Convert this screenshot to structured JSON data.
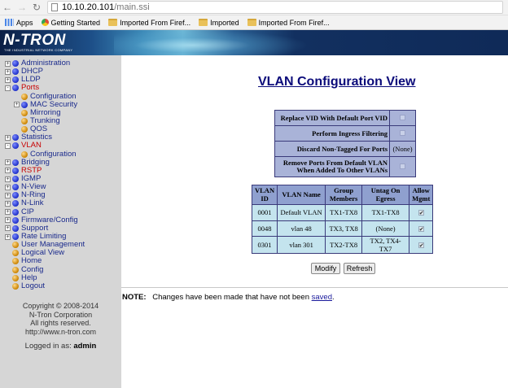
{
  "browser": {
    "url_host": "10.10.20.101",
    "url_path": "/main.ssi",
    "bookmarks": [
      "Apps",
      "Getting Started",
      "Imported From Firef...",
      "Imported",
      "Imported From Firef..."
    ]
  },
  "banner": {
    "logo": "N-TRON",
    "tagline": "THE INDUSTRIAL NETWORK COMPANY"
  },
  "sidebar": {
    "items": [
      {
        "label": "Administration",
        "level": 0,
        "expander": "+",
        "icon": "blue-ball-icon"
      },
      {
        "label": "DHCP",
        "level": 0,
        "expander": "+",
        "icon": "blue-ball-icon"
      },
      {
        "label": "LLDP",
        "level": 0,
        "expander": "+",
        "icon": "blue-ball-icon"
      },
      {
        "label": "Ports",
        "level": 0,
        "expander": "-",
        "icon": "blue-ball-icon",
        "red": true
      },
      {
        "label": "Configuration",
        "level": 1,
        "expander": "",
        "icon": "gold-ball-icon"
      },
      {
        "label": "MAC Security",
        "level": 1,
        "expander": "+",
        "icon": "blue-ball-icon"
      },
      {
        "label": "Mirroring",
        "level": 1,
        "expander": "",
        "icon": "gold-ball-icon"
      },
      {
        "label": "Trunking",
        "level": 1,
        "expander": "",
        "icon": "gold-ball-icon"
      },
      {
        "label": "QOS",
        "level": 1,
        "expander": "",
        "icon": "gold-ball-icon"
      },
      {
        "label": "Statistics",
        "level": 0,
        "expander": "+",
        "icon": "blue-ball-icon"
      },
      {
        "label": "VLAN",
        "level": 0,
        "expander": "-",
        "icon": "blue-ball-icon",
        "red": true
      },
      {
        "label": "Configuration",
        "level": 1,
        "expander": "",
        "icon": "gold-ball-icon"
      },
      {
        "label": "Bridging",
        "level": 0,
        "expander": "+",
        "icon": "blue-ball-icon"
      },
      {
        "label": "RSTP",
        "level": 0,
        "expander": "+",
        "icon": "blue-ball-icon",
        "red": true
      },
      {
        "label": "IGMP",
        "level": 0,
        "expander": "+",
        "icon": "blue-ball-icon"
      },
      {
        "label": "N-View",
        "level": 0,
        "expander": "+",
        "icon": "blue-ball-icon"
      },
      {
        "label": "N-Ring",
        "level": 0,
        "expander": "+",
        "icon": "blue-ball-icon"
      },
      {
        "label": "N-Link",
        "level": 0,
        "expander": "+",
        "icon": "blue-ball-icon"
      },
      {
        "label": "CIP",
        "level": 0,
        "expander": "+",
        "icon": "blue-ball-icon"
      },
      {
        "label": "Firmware/Config",
        "level": 0,
        "expander": "+",
        "icon": "blue-ball-icon"
      },
      {
        "label": "Support",
        "level": 0,
        "expander": "+",
        "icon": "blue-ball-icon"
      },
      {
        "label": "Rate Limiting",
        "level": 0,
        "expander": "+",
        "icon": "blue-ball-icon"
      },
      {
        "label": "User Management",
        "level": 0,
        "expander": "",
        "icon": "gold-ball-icon"
      },
      {
        "label": "Logical View",
        "level": 0,
        "expander": "",
        "icon": "gold-ball-icon"
      },
      {
        "label": "Home",
        "level": 0,
        "expander": "",
        "icon": "gold-ball-icon"
      },
      {
        "label": "Config",
        "level": 0,
        "expander": "",
        "icon": "gold-ball-icon"
      },
      {
        "label": "Help",
        "level": 0,
        "expander": "",
        "icon": "gold-ball-icon"
      },
      {
        "label": "Logout",
        "level": 0,
        "expander": "",
        "icon": "gold-ball-icon"
      }
    ],
    "copyright_lines": [
      "Copyright © 2008-2014",
      "N-Tron Corporation",
      "All rights reserved.",
      "http://www.n-tron.com"
    ],
    "logged_in_label": "Logged in as:",
    "logged_in_user": "admin"
  },
  "main": {
    "title": "VLAN Configuration View",
    "options": [
      {
        "label": "Replace VID With Default Port VID",
        "value": "",
        "type": "checkbox"
      },
      {
        "label": "Perform Ingress Filtering",
        "value": "",
        "type": "checkbox"
      },
      {
        "label": "Discard Non-Tagged For Ports",
        "value": "(None)",
        "type": "text"
      },
      {
        "label": "Remove Ports From Default VLAN When Added To Other VLANs",
        "value": "",
        "type": "checkbox"
      }
    ],
    "vlan_table": {
      "headers": [
        "VLAN ID",
        "VLAN Name",
        "Group Members",
        "Untag On Egress",
        "Allow Mgmt"
      ],
      "rows": [
        [
          "0001",
          "Default VLAN",
          "TX1-TX8",
          "TX1-TX8",
          "✔"
        ],
        [
          "0048",
          "vlan 48",
          "TX3, TX8",
          "(None)",
          "✔"
        ],
        [
          "0301",
          "vlan 301",
          "TX2-TX8",
          "TX2, TX4-TX7",
          "✔"
        ]
      ]
    },
    "modify_label": "Modify",
    "refresh_label": "Refresh",
    "note_label": "NOTE:",
    "note_text": "Changes have been made that have not been",
    "note_link": "saved",
    "note_end": "."
  }
}
